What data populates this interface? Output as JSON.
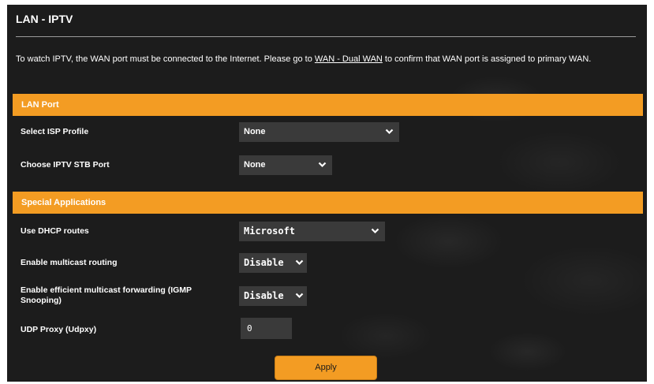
{
  "page": {
    "title": "LAN - IPTV",
    "intro_before": "To watch IPTV, the WAN port must be connected to the Internet. Please go to ",
    "intro_link": "WAN - Dual WAN",
    "intro_after": " to confirm that WAN port is assigned to primary WAN."
  },
  "lan_port": {
    "header": "LAN Port",
    "isp_profile": {
      "label": "Select ISP Profile",
      "value": "None"
    },
    "stb_port": {
      "label": "Choose IPTV STB Port",
      "value": "None"
    }
  },
  "special_apps": {
    "header": "Special Applications",
    "dhcp_routes": {
      "label": "Use DHCP routes",
      "value": "Microsoft"
    },
    "multicast_routing": {
      "label": "Enable multicast routing",
      "value": "Disable"
    },
    "igmp_snooping": {
      "label": "Enable efficient multicast forwarding (IGMP Snooping)",
      "value": "Disable"
    },
    "udp_proxy": {
      "label": "UDP Proxy (Udpxy)",
      "value": "0"
    }
  },
  "actions": {
    "apply_label": "Apply"
  },
  "colors": {
    "accent": "#f39c23",
    "panel_bg": "#1c1c1c",
    "control_bg": "#3a3a3a",
    "text": "#ffffff"
  },
  "icons": {
    "dropdown": "chevron-down-icon"
  }
}
